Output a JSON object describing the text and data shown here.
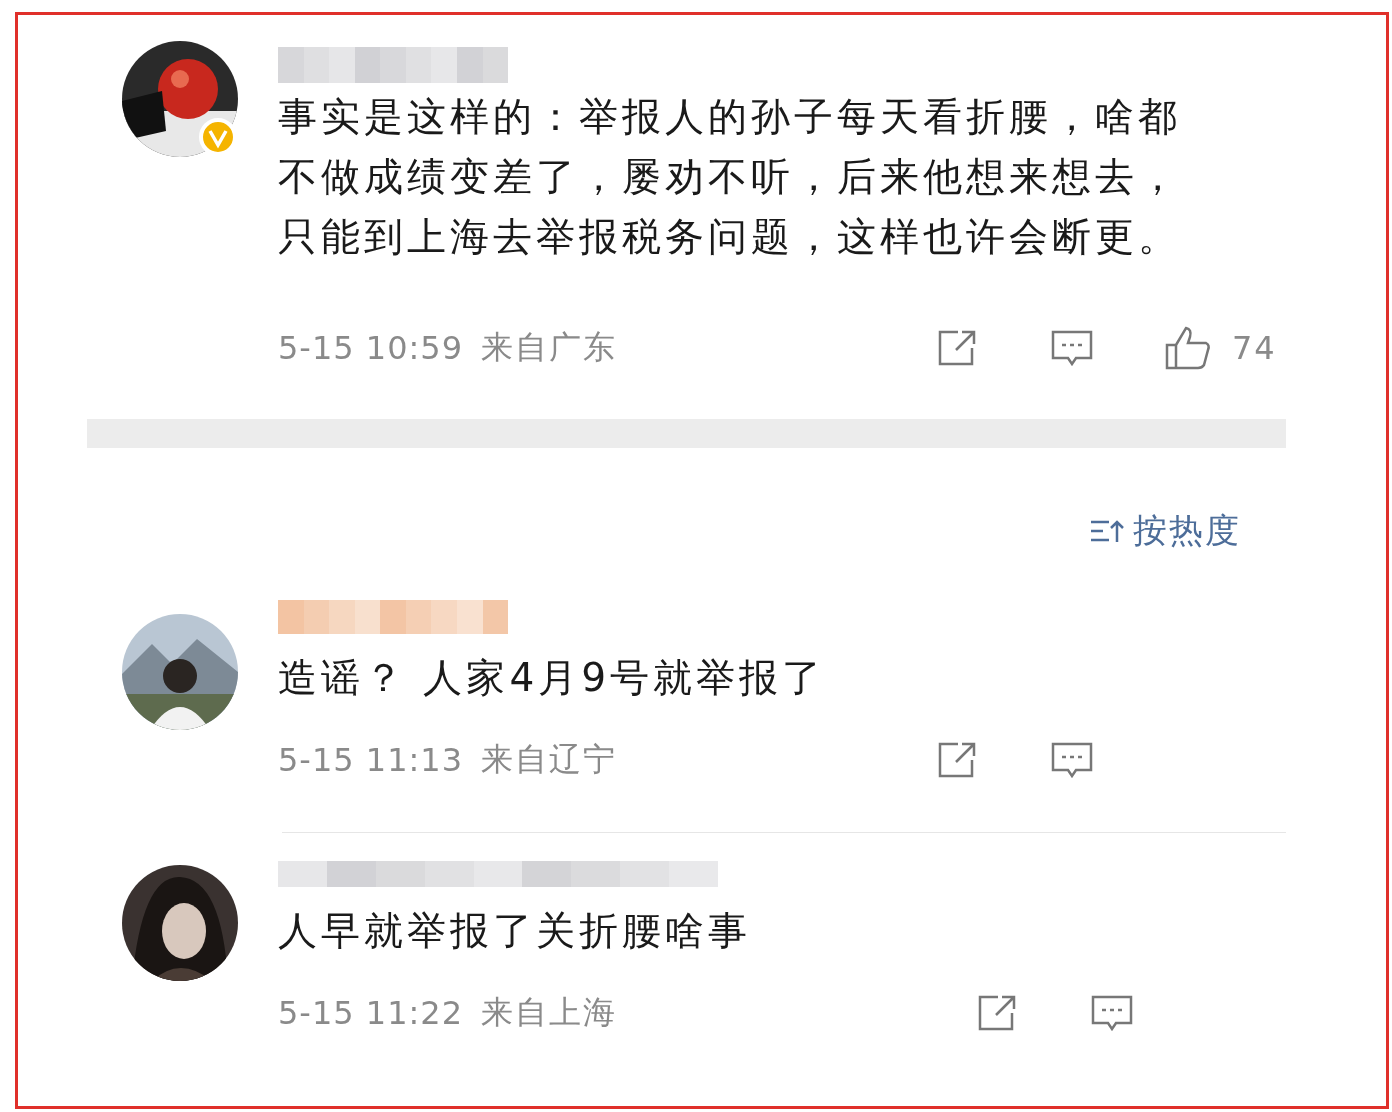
{
  "comments": [
    {
      "verified": true,
      "text": "事实是这样的：举报人的孙子每天看折腰，啥都不做成绩变差了，屡劝不听，后来他想来想去，只能到上海去举报税务问题，这样也许会断更。",
      "time": "5-15 10:59",
      "location": "来自广东",
      "likes": "74"
    },
    {
      "verified": false,
      "text": "造谣？ 人家4月9号就举报了",
      "time": "5-15 11:13",
      "location": "来自辽宁"
    },
    {
      "verified": false,
      "text": "人早就举报了关折腰啥事",
      "time": "5-15 11:22",
      "location": "来自上海"
    }
  ],
  "sort": {
    "label": "按热度"
  }
}
